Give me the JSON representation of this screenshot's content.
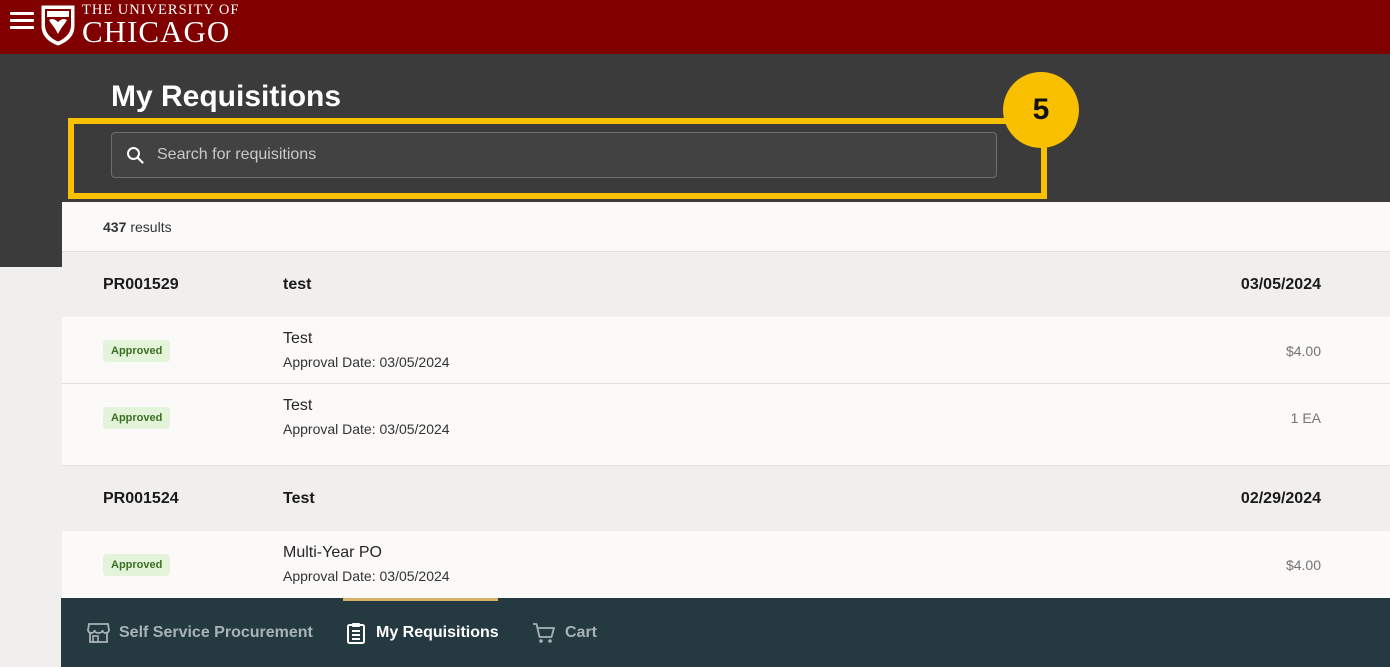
{
  "header": {
    "logo_line1": "THE UNIVERSITY OF",
    "logo_line2": "CHICAGO",
    "brand_color": "#800000",
    "menu_icon": "hamburger-icon"
  },
  "page": {
    "title": "My Requisitions"
  },
  "search": {
    "placeholder": "Search for requisitions",
    "value": "",
    "icon": "search-icon"
  },
  "callout": {
    "step": "5",
    "color": "#f9c000"
  },
  "results": {
    "count": "437",
    "label": "results"
  },
  "requisitions": [
    {
      "id": "PR001529",
      "title": "test",
      "date": "03/05/2024",
      "lines": [
        {
          "status": "Approved",
          "description": "Test",
          "approval": "Approval Date: 03/05/2024",
          "amount": "$4.00"
        },
        {
          "status": "Approved",
          "description": "Test",
          "approval": "Approval Date: 03/05/2024",
          "amount": "1 EA"
        }
      ]
    },
    {
      "id": "PR001524",
      "title": "Test",
      "date": "02/29/2024",
      "lines": [
        {
          "status": "Approved",
          "description": "Multi-Year PO",
          "approval": "Approval Date: 03/05/2024",
          "amount": "$4.00"
        }
      ]
    }
  ],
  "bottom_nav": [
    {
      "label": "Self Service Procurement",
      "icon": "storefront-icon",
      "active": false
    },
    {
      "label": "My Requisitions",
      "icon": "clipboard-list-icon",
      "active": true
    },
    {
      "label": "Cart",
      "icon": "cart-icon",
      "active": false
    }
  ]
}
